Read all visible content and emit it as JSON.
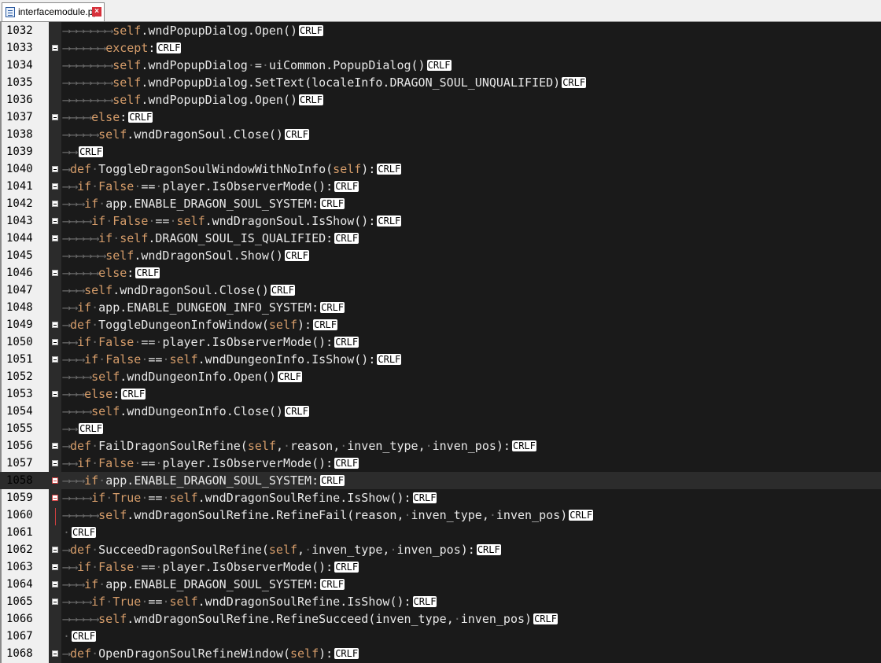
{
  "tab": {
    "filename": "interfacemodule.py",
    "close_glyph": "×"
  },
  "eol_marker": "CRLF",
  "lines": [
    {
      "num": "1032",
      "fold": false,
      "ws": "⟶⟶⟶⟶⟶⟶⟶",
      "code": "self.wndPopupDialog.Open()"
    },
    {
      "num": "1033",
      "fold": true,
      "ws": "⟶⟶⟶⟶⟶⟶",
      "code": "except:"
    },
    {
      "num": "1034",
      "fold": false,
      "ws": "⟶⟶⟶⟶⟶⟶⟶",
      "code": "self.wndPopupDialog·=·uiCommon.PopupDialog()"
    },
    {
      "num": "1035",
      "fold": false,
      "ws": "⟶⟶⟶⟶⟶⟶⟶",
      "code": "self.wndPopupDialog.SetText(localeInfo.DRAGON_SOUL_UNQUALIFIED)"
    },
    {
      "num": "1036",
      "fold": false,
      "ws": "⟶⟶⟶⟶⟶⟶⟶",
      "code": "self.wndPopupDialog.Open()"
    },
    {
      "num": "1037",
      "fold": true,
      "ws": "⟶⟶⟶⟶",
      "code": "else:"
    },
    {
      "num": "1038",
      "fold": false,
      "ws": "⟶⟶⟶⟶⟶",
      "code": "self.wndDragonSoul.Close()"
    },
    {
      "num": "1039",
      "fold": false,
      "ws": "⟶⟶",
      "code": ""
    },
    {
      "num": "1040",
      "fold": true,
      "ws": "⟶",
      "code": "def·ToggleDragonSoulWindowWithNoInfo(self):"
    },
    {
      "num": "1041",
      "fold": true,
      "ws": "⟶⟶",
      "code": "if·False·==·player.IsObserverMode():"
    },
    {
      "num": "1042",
      "fold": true,
      "ws": "⟶⟶⟶",
      "code": "if·app.ENABLE_DRAGON_SOUL_SYSTEM:"
    },
    {
      "num": "1043",
      "fold": true,
      "ws": "⟶⟶⟶⟶",
      "code": "if·False·==·self.wndDragonSoul.IsShow():"
    },
    {
      "num": "1044",
      "fold": true,
      "ws": "⟶⟶⟶⟶⟶",
      "code": "if·self.DRAGON_SOUL_IS_QUALIFIED:"
    },
    {
      "num": "1045",
      "fold": false,
      "ws": "⟶⟶⟶⟶⟶⟶",
      "code": "self.wndDragonSoul.Show()"
    },
    {
      "num": "1046",
      "fold": true,
      "ws": "⟶⟶⟶⟶⟶",
      "code": "else:"
    },
    {
      "num": "1047",
      "fold": false,
      "ws": "⟶⟶⟶",
      "code": "self.wndDragonSoul.Close()"
    },
    {
      "num": "1048",
      "fold": false,
      "ws": "⟶⟶",
      "code": "if·app.ENABLE_DUNGEON_INFO_SYSTEM:"
    },
    {
      "num": "1049",
      "fold": true,
      "ws": "⟶",
      "code": "def·ToggleDungeonInfoWindow(self):"
    },
    {
      "num": "1050",
      "fold": true,
      "ws": "⟶⟶",
      "code": "if·False·==·player.IsObserverMode():"
    },
    {
      "num": "1051",
      "fold": true,
      "ws": "⟶⟶⟶",
      "code": "if·False·==·self.wndDungeonInfo.IsShow():"
    },
    {
      "num": "1052",
      "fold": false,
      "ws": "⟶⟶⟶⟶",
      "code": "self.wndDungeonInfo.Open()"
    },
    {
      "num": "1053",
      "fold": true,
      "ws": "⟶⟶⟶",
      "code": "else:"
    },
    {
      "num": "1054",
      "fold": false,
      "ws": "⟶⟶⟶⟶",
      "code": "self.wndDungeonInfo.Close()"
    },
    {
      "num": "1055",
      "fold": false,
      "ws": "⟶⟶",
      "code": ""
    },
    {
      "num": "1056",
      "fold": true,
      "ws": "⟶",
      "code": "def·FailDragonSoulRefine(self,·reason,·inven_type,·inven_pos):"
    },
    {
      "num": "1057",
      "fold": true,
      "ws": "⟶⟶",
      "code": "if·False·==·player.IsObserverMode():"
    },
    {
      "num": "1058",
      "fold": "red",
      "ws": "⟶⟶⟶",
      "code": "if·app.ENABLE_DRAGON_SOUL_SYSTEM:",
      "current": true
    },
    {
      "num": "1059",
      "fold": "red",
      "ws": "⟶⟶⟶⟶",
      "code": "if·True·==·self.wndDragonSoulRefine.IsShow():"
    },
    {
      "num": "1060",
      "fold": false,
      "ws": "⟶⟶⟶⟶⟶",
      "code": "self.wndDragonSoulRefine.RefineFail(reason,·inven_type,·inven_pos)"
    },
    {
      "num": "1061",
      "fold": false,
      "ws": "",
      "code": "·"
    },
    {
      "num": "1062",
      "fold": true,
      "ws": "⟶",
      "code": "def·SucceedDragonSoulRefine(self,·inven_type,·inven_pos):"
    },
    {
      "num": "1063",
      "fold": true,
      "ws": "⟶⟶",
      "code": "if·False·==·player.IsObserverMode():"
    },
    {
      "num": "1064",
      "fold": true,
      "ws": "⟶⟶⟶",
      "code": "if·app.ENABLE_DRAGON_SOUL_SYSTEM:"
    },
    {
      "num": "1065",
      "fold": true,
      "ws": "⟶⟶⟶⟶",
      "code": "if·True·==·self.wndDragonSoulRefine.IsShow():"
    },
    {
      "num": "1066",
      "fold": false,
      "ws": "⟶⟶⟶⟶⟶",
      "code": "self.wndDragonSoulRefine.RefineSucceed(inven_type,·inven_pos)"
    },
    {
      "num": "1067",
      "fold": false,
      "ws": "",
      "code": "·"
    },
    {
      "num": "1068",
      "fold": true,
      "ws": "⟶",
      "code": "def·OpenDragonSoulRefineWindow(self):"
    }
  ]
}
